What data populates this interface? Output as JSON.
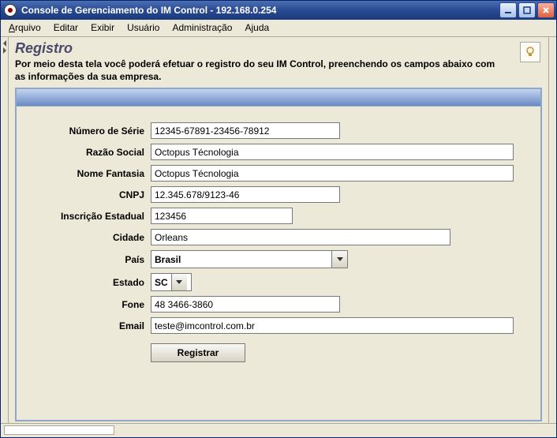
{
  "window": {
    "title": "Console de Gerenciamento do IM Control - 192.168.0.254"
  },
  "menu": {
    "arquivo": "Arquivo",
    "editar": "Editar",
    "exibir": "Exibir",
    "usuario": "Usuário",
    "administracao": "Administração",
    "ajuda": "Ajuda"
  },
  "page": {
    "title": "Registro",
    "description": "Por meio desta tela você poderá efetuar o registro do seu IM Control, preenchendo os campos abaixo com as informações da sua empresa."
  },
  "form": {
    "labels": {
      "serial": "Número de Série",
      "razao": "Razão Social",
      "fantasia": "Nome Fantasia",
      "cnpj": "CNPJ",
      "inscricao": "Inscrição Estadual",
      "cidade": "Cidade",
      "pais": "País",
      "estado": "Estado",
      "fone": "Fone",
      "email": "Email"
    },
    "values": {
      "serial": "12345-67891-23456-78912",
      "razao": "Octopus Técnologia",
      "fantasia": "Octopus Técnologia",
      "cnpj": "12.345.678/9123-46",
      "inscricao": "123456",
      "cidade": "Orleans",
      "pais": "Brasil",
      "estado": "SC",
      "fone": "48 3466-3860",
      "email": "teste@imcontrol.com.br"
    },
    "submit_label": "Registrar"
  }
}
